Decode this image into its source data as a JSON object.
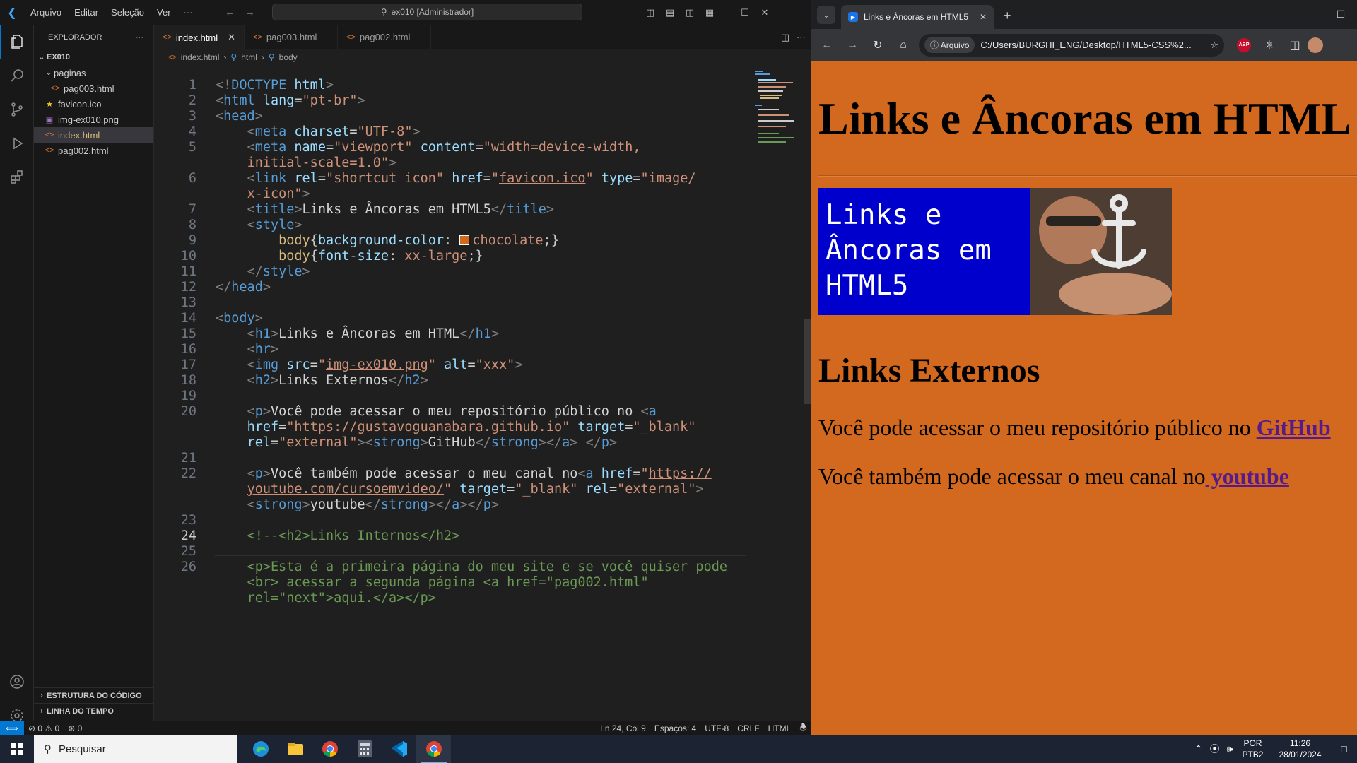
{
  "vscode": {
    "menu": [
      "Arquivo",
      "Editar",
      "Seleção",
      "Ver",
      "···"
    ],
    "command_center": "ex010 [Administrador]",
    "explorer": {
      "header": "EXPLORADOR",
      "header_more": "···",
      "folder": "EX010",
      "items": [
        {
          "label": "paginas",
          "kind": "folder"
        },
        {
          "label": "pag003.html",
          "kind": "html"
        },
        {
          "label": "favicon.ico",
          "kind": "ico"
        },
        {
          "label": "img-ex010.png",
          "kind": "png"
        },
        {
          "label": "index.html",
          "kind": "html",
          "selected": true
        },
        {
          "label": "pag002.html",
          "kind": "html"
        }
      ],
      "outline": "ESTRUTURA DO CÓDIGO",
      "timeline": "LINHA DO TEMPO"
    },
    "tabs": [
      {
        "label": "index.html",
        "active": true
      },
      {
        "label": "pag003.html",
        "active": false
      },
      {
        "label": "pag002.html",
        "active": false
      }
    ],
    "breadcrumb": [
      "index.html",
      "html",
      "body"
    ],
    "line_numbers": [
      "1",
      "2",
      "3",
      "4",
      "5",
      "",
      "6",
      "",
      "7",
      "8",
      "9",
      "10",
      "11",
      "12",
      "13",
      "14",
      "15",
      "16",
      "17",
      "18",
      "19",
      "20",
      "",
      "",
      "21",
      "22",
      "",
      "",
      "23",
      "24",
      "25",
      "26",
      "",
      ""
    ],
    "current_line": "24",
    "status": {
      "errors": "0",
      "warnings": "0",
      "ports": "0",
      "cursor": "Ln 24, Col 9",
      "spaces": "Espaços: 4",
      "encoding": "UTF-8",
      "eol": "CRLF",
      "language": "HTML"
    }
  },
  "chrome": {
    "tab_title": "Links e Âncoras em HTML5",
    "tab_favicon_icon": "play-icon",
    "address_chip": "Arquivo",
    "address": "C:/Users/BURGHI_ENG/Desktop/HTML5-CSS%2...",
    "extension_label": "ABP",
    "page": {
      "h1": "Links e Âncoras em HTML",
      "banner_text": "Links e\nÂncoras em\nHTML5",
      "h2": "Links Externos",
      "p1_text": "Você pode acessar o meu repositório público no ",
      "p1_link": "GitHub",
      "p2_text": "Você também pode acessar o meu canal no",
      "p2_link": " youtube",
      "background_color": "#d2691e"
    }
  },
  "taskbar": {
    "search_placeholder": "Pesquisar",
    "apps": [
      "edge-icon",
      "file-explorer-icon",
      "chrome-icon",
      "calculator-icon",
      "vscode-icon",
      "chrome-icon"
    ],
    "lang_top": "POR",
    "lang_bottom": "PTB2",
    "time": "11:26",
    "date": "28/01/2024"
  },
  "colors": {
    "vscode_accent": "#0078d4",
    "page_background": "#d2691e",
    "link_visited": "#551a8b"
  }
}
